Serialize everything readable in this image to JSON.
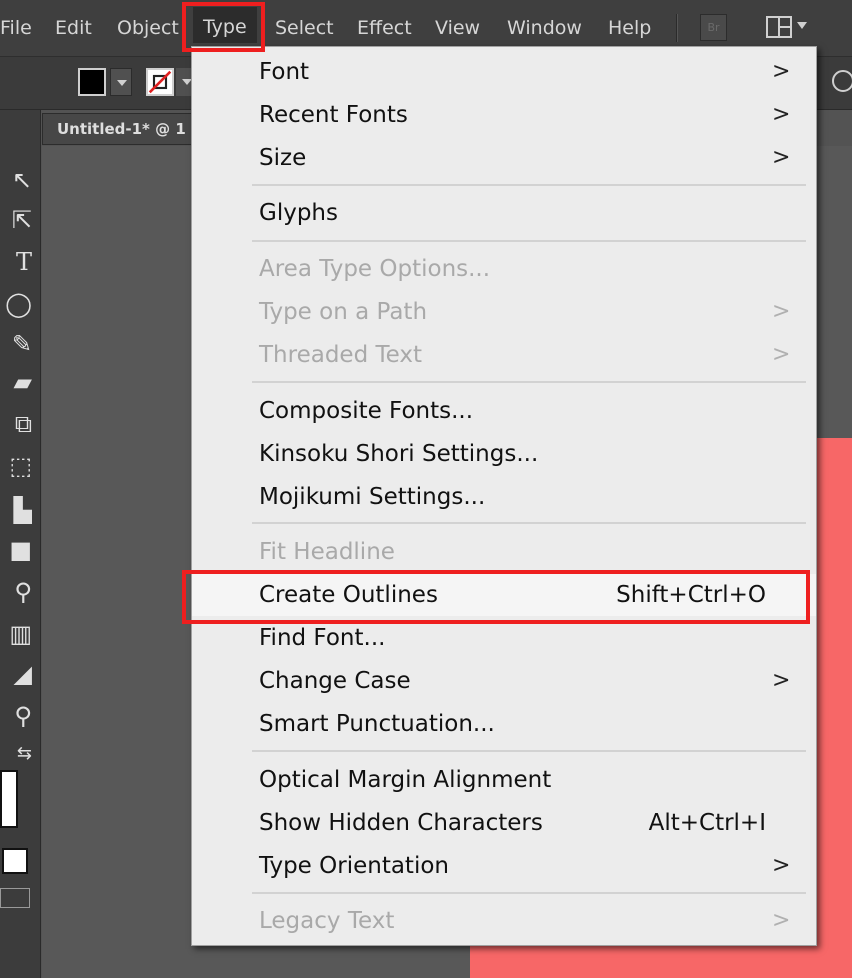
{
  "menubar": {
    "items": [
      "File",
      "Edit",
      "Object",
      "Type",
      "Select",
      "Effect",
      "View",
      "Window",
      "Help"
    ],
    "bridge_label": "Br"
  },
  "document": {
    "tab_title": "Untitled-1* @ 1"
  },
  "type_menu": {
    "font": "Font",
    "recent_fonts": "Recent Fonts",
    "size": "Size",
    "glyphs": "Glyphs",
    "area_type_options": "Area Type Options...",
    "type_on_a_path": "Type on a Path",
    "threaded_text": "Threaded Text",
    "composite_fonts": "Composite Fonts...",
    "kinsoku_shori_settings": "Kinsoku Shori Settings...",
    "mojikumi_settings": "Mojikumi Settings...",
    "fit_headline": "Fit Headline",
    "create_outlines": "Create Outlines",
    "create_outlines_shortcut": "Shift+Ctrl+O",
    "find_font": "Find Font...",
    "change_case": "Change Case",
    "smart_punctuation": "Smart Punctuation...",
    "optical_margin_alignment": "Optical Margin Alignment",
    "show_hidden_characters": "Show Hidden Characters",
    "show_hidden_characters_shortcut": "Alt+Ctrl+I",
    "type_orientation": "Type Orientation",
    "legacy_text": "Legacy Text",
    "submenu_arrow": ">"
  },
  "colors": {
    "highlight_outline": "#ee1f1f",
    "artboard_fill": "#f76767",
    "menu_background": "#ececec",
    "disabled_text": "#a9a9a9"
  },
  "icons": {
    "tools": [
      "selection-icon",
      "direct-selection-icon",
      "type-icon",
      "ellipse-icon",
      "pencil-icon",
      "eraser-icon",
      "scale-icon",
      "free-transform-icon",
      "graph-icon",
      "gradient-icon",
      "eyedropper-icon",
      "column-graph-icon",
      "paint-bucket-icon",
      "zoom-icon",
      "swap-icon"
    ]
  }
}
